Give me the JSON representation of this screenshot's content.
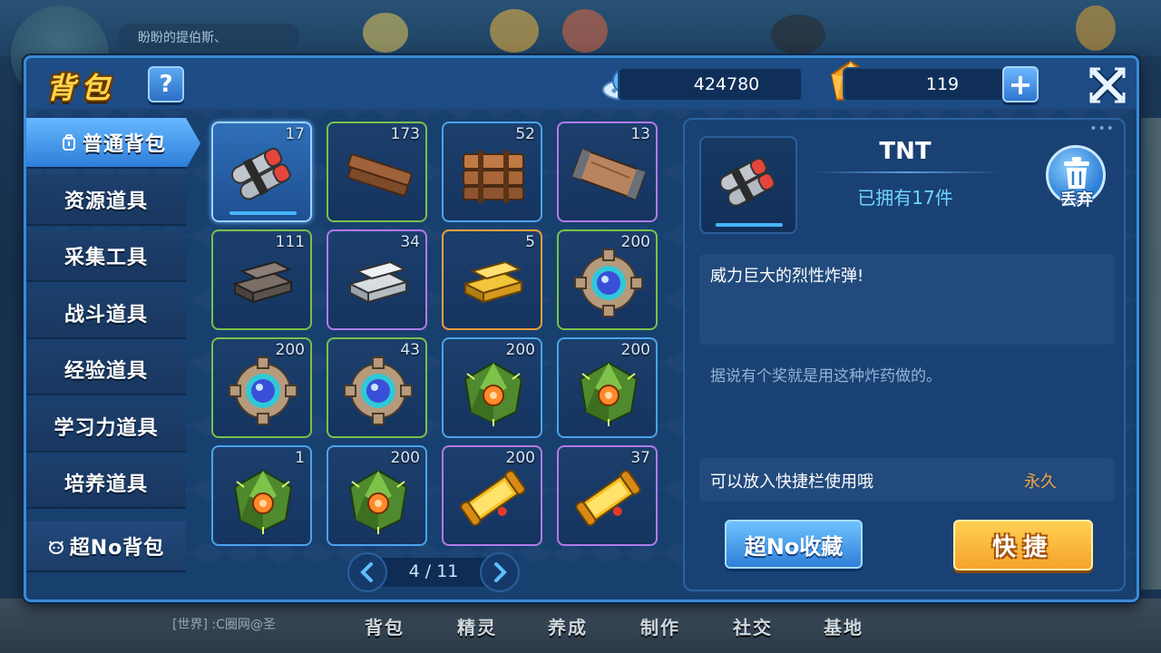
{
  "background": {
    "chat_top": "盼盼的提伯斯、",
    "chat_bottom": "[世界] :C圈网@圣",
    "nav": [
      "背包",
      "精灵",
      "养成",
      "制作",
      "社交",
      "基地"
    ]
  },
  "header": {
    "title": "背包",
    "help_label": "?",
    "coins": "424780",
    "gems": "119",
    "add_label": "+"
  },
  "sidebar": {
    "items": [
      {
        "label": "普通背包",
        "icon": "backpack-icon",
        "active": true
      },
      {
        "label": "资源道具"
      },
      {
        "label": "采集工具"
      },
      {
        "label": "战斗道具"
      },
      {
        "label": "经验道具"
      },
      {
        "label": "学习力道具"
      },
      {
        "label": "培养道具"
      }
    ],
    "bottom_item": {
      "label": "超No背包",
      "icon": "cat-icon"
    }
  },
  "grid": {
    "slots": [
      {
        "item": "tnt",
        "count": "17",
        "rarity": "blue",
        "selected": true
      },
      {
        "item": "wood-plank",
        "count": "173",
        "rarity": "green"
      },
      {
        "item": "wood-bundle",
        "count": "52",
        "rarity": "blue"
      },
      {
        "item": "wood-board",
        "count": "13",
        "rarity": "purple"
      },
      {
        "item": "iron-ingot",
        "count": "111",
        "rarity": "green"
      },
      {
        "item": "silver-ingot",
        "count": "34",
        "rarity": "purple"
      },
      {
        "item": "gold-ingot",
        "count": "5",
        "rarity": "orange"
      },
      {
        "item": "gear-core",
        "count": "200",
        "rarity": "green"
      },
      {
        "item": "gear-core",
        "count": "200",
        "rarity": "green"
      },
      {
        "item": "gear-core",
        "count": "43",
        "rarity": "green"
      },
      {
        "item": "green-crystal",
        "count": "200",
        "rarity": "blue"
      },
      {
        "item": "green-crystal",
        "count": "200",
        "rarity": "blue"
      },
      {
        "item": "green-crystal",
        "count": "1",
        "rarity": "blue"
      },
      {
        "item": "green-crystal",
        "count": "200",
        "rarity": "blue"
      },
      {
        "item": "gold-scroll",
        "count": "200",
        "rarity": "purple"
      },
      {
        "item": "gold-scroll",
        "count": "37",
        "rarity": "purple"
      }
    ],
    "pager": "4 / 11"
  },
  "detail": {
    "name": "TNT",
    "owned": "已拥有17件",
    "discard_label": "丢弃",
    "description": "威力巨大的烈性炸弹!",
    "flavor": "据说有个奖就是用这种炸药做的。",
    "info_left": "可以放入快捷栏使用哦",
    "info_right": "永久",
    "collect_label": "超No收藏",
    "quick_label": "快捷"
  },
  "colors": {
    "rarity_green": "#79c14a",
    "rarity_blue": "#4aa3ec",
    "rarity_purple": "#b07be6",
    "rarity_orange": "#f0a03c",
    "title_gold": "#ffd54a",
    "quick_orange": "#f5a22a"
  }
}
